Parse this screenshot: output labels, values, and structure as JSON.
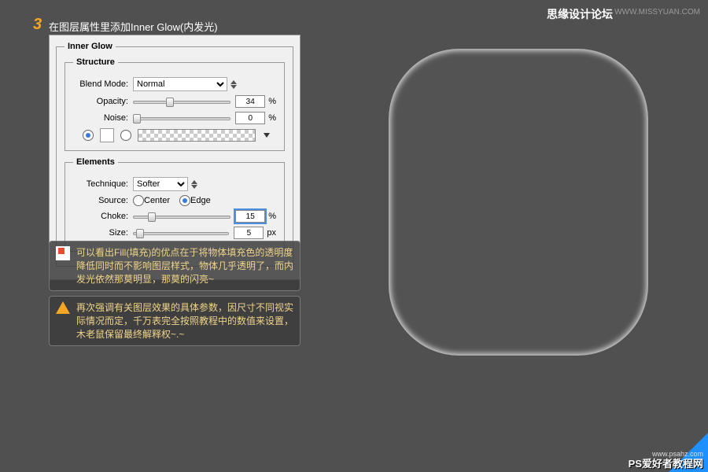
{
  "header": {
    "siteName": "思缘设计论坛",
    "siteUrl": "WWW.MISSYUAN.COM"
  },
  "step": {
    "number": "3",
    "text": "在图层属性里添加Inner Glow(内发光)"
  },
  "panel": {
    "title": "Inner Glow",
    "structure": {
      "legend": "Structure",
      "blendModeLabel": "Blend Mode:",
      "blendModeValue": "Normal",
      "opacityLabel": "Opacity:",
      "opacityValue": "34",
      "opacityUnit": "%",
      "noiseLabel": "Noise:",
      "noiseValue": "0",
      "noiseUnit": "%"
    },
    "elements": {
      "legend": "Elements",
      "techniqueLabel": "Technique:",
      "techniqueValue": "Softer",
      "sourceLabel": "Source:",
      "centerLabel": "Center",
      "edgeLabel": "Edge",
      "chokeLabel": "Choke:",
      "chokeValue": "15",
      "chokeUnit": "%",
      "sizeLabel": "Size:",
      "sizeValue": "5",
      "sizeUnit": "px"
    }
  },
  "notes": {
    "n1": "可以看出Fill(填充)的优点在于将物体填充色的透明度降低同时而不影响图层样式，物体几乎透明了，而内发光依然那莫明显，那莫的闪亮~",
    "n2": "再次强调有关图层效果的具体参数，因尺寸不同视实际情况而定，千万表完全按照教程中的数值来设置，木老鼠保留最终解释权~.~"
  },
  "footer": {
    "brand": "PS爱好者教程网",
    "url": "www.psahz.com"
  }
}
